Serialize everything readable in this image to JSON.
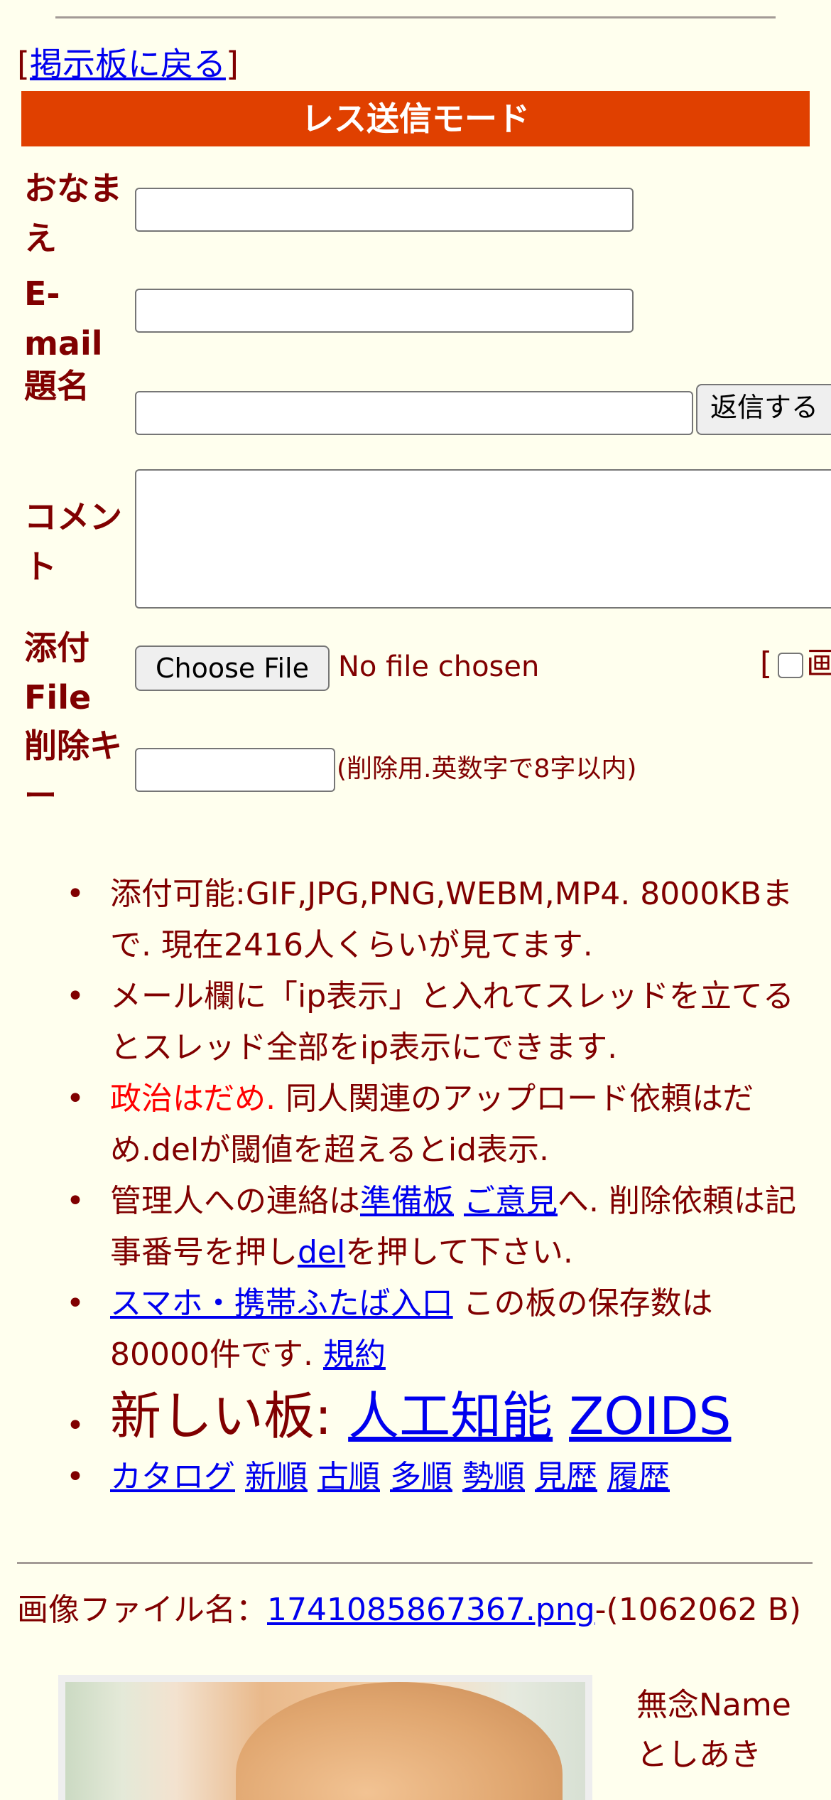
{
  "nav": {
    "bracket_open": "[",
    "back_label": "掲示板に戻る",
    "bracket_close": "]"
  },
  "form": {
    "mode_title": "レス送信モード",
    "labels": {
      "name": "おなまえ",
      "email": "E-mail",
      "subject": "題名",
      "comment": "コメント",
      "attach": "添付File",
      "delkey": "削除キー"
    },
    "submit_label": "返信する",
    "choose_file_label": "Choose File",
    "file_status": "No file chosen",
    "image_flag_prefix": "[",
    "image_flag_label": "画",
    "delkey_note": "(削除用.英数字で8字以内)",
    "values": {
      "name": "",
      "email": "",
      "subject": "",
      "comment": "",
      "delkey": ""
    }
  },
  "rules": {
    "r1": "添付可能:GIF,JPG,PNG,WEBM,MP4. 8000KBまで. 現在2416人くらいが見てます.",
    "r2": "メール欄に「ip表示」と入れてスレッドを立てるとスレッド全部をip表示にできます.",
    "r3_red": "政治はだめ.",
    "r3_rest": " 同人関連のアップロード依頼はだめ.delが閾値を超えるとid表示.",
    "r4_pre": "管理人への連絡は",
    "r4_link1": "準備板",
    "r4_link2": "ご意見",
    "r4_mid": "へ. 削除依頼は記事番号を押し",
    "r4_link3": "del",
    "r4_post": "を押して下さい.",
    "r5_link": "スマホ・携帯ふたば入口",
    "r5_mid": " この板の保存数は80000件です. ",
    "r5_link2": "規約",
    "r6_pre": "新しい板: ",
    "r6_link1": "人工知能",
    "r6_link2": "ZOIDS",
    "sort_links": [
      "カタログ",
      "新順",
      "古順",
      "多順",
      "勢順",
      "見歴",
      "履歴"
    ]
  },
  "post": {
    "file_prefix": "画像ファイル名：",
    "file_name": "1741085867367.png",
    "file_size": "-(1062062 B)",
    "poster_name": "無念Name",
    "poster_id": "としあき"
  }
}
